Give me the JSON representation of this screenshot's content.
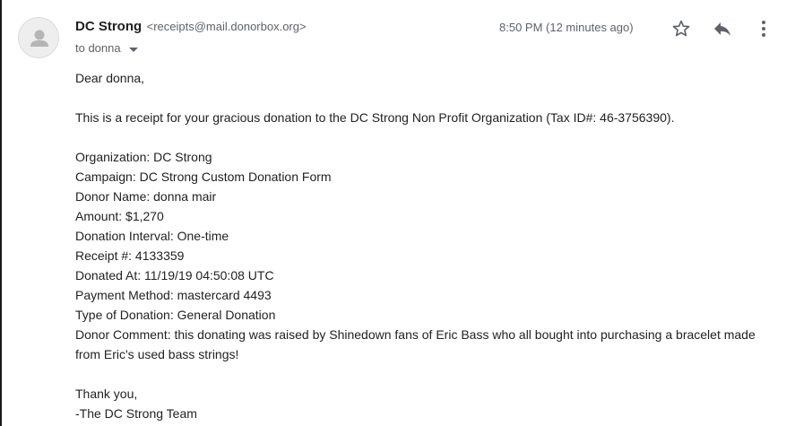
{
  "email": {
    "sender_name": "DC Strong",
    "sender_email": "<receipts@mail.donorbox.org>",
    "to_label": "to donna",
    "time": "8:50 PM (12 minutes ago)",
    "greeting": "Dear donna,",
    "intro": "This is a receipt for your gracious donation to the DC Strong Non Profit Organization (Tax ID#: 46-3756390).",
    "details": [
      "Organization: DC Strong",
      "Campaign: DC Strong Custom Donation Form",
      "Donor Name: donna mair",
      "Amount: $1,270",
      "Donation Interval: One-time",
      "Receipt #: 4133359",
      "Donated At: 11/19/19 04:50:08 UTC",
      "Payment Method: mastercard 4493",
      "Type of Donation: General Donation",
      "Donor Comment: this donating was raised by Shinedown fans of Eric Bass who all bought into purchasing a bracelet made from Eric's used bass strings!"
    ],
    "closing": "Thank you,",
    "signature": "-The DC Strong Team"
  },
  "icons": {
    "avatar": "person-icon",
    "caret": "chevron-down-icon",
    "star": "star-icon",
    "reply": "reply-icon",
    "more": "more-vert-icon"
  }
}
